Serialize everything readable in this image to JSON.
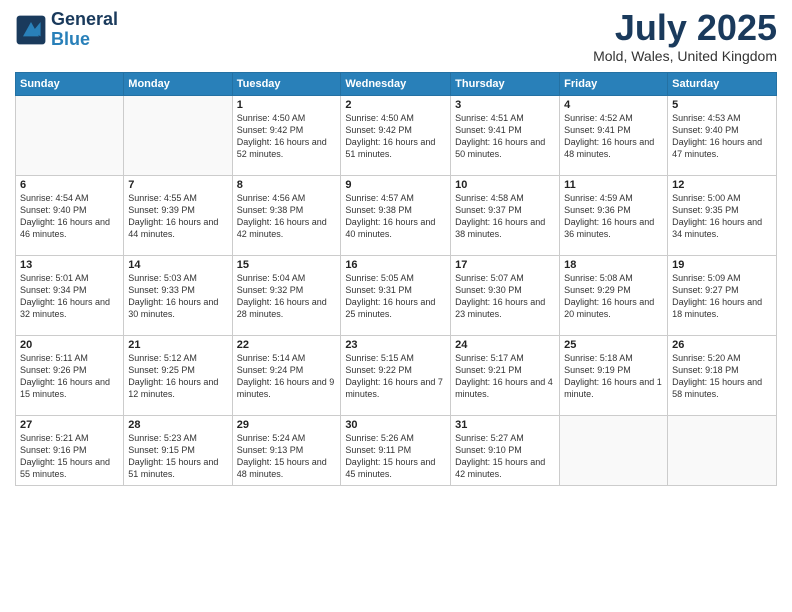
{
  "logo": {
    "line1": "General",
    "line2": "Blue"
  },
  "header": {
    "month": "July 2025",
    "location": "Mold, Wales, United Kingdom"
  },
  "days_of_week": [
    "Sunday",
    "Monday",
    "Tuesday",
    "Wednesday",
    "Thursday",
    "Friday",
    "Saturday"
  ],
  "weeks": [
    [
      {
        "day": "",
        "info": ""
      },
      {
        "day": "",
        "info": ""
      },
      {
        "day": "1",
        "info": "Sunrise: 4:50 AM\nSunset: 9:42 PM\nDaylight: 16 hours and 52 minutes."
      },
      {
        "day": "2",
        "info": "Sunrise: 4:50 AM\nSunset: 9:42 PM\nDaylight: 16 hours and 51 minutes."
      },
      {
        "day": "3",
        "info": "Sunrise: 4:51 AM\nSunset: 9:41 PM\nDaylight: 16 hours and 50 minutes."
      },
      {
        "day": "4",
        "info": "Sunrise: 4:52 AM\nSunset: 9:41 PM\nDaylight: 16 hours and 48 minutes."
      },
      {
        "day": "5",
        "info": "Sunrise: 4:53 AM\nSunset: 9:40 PM\nDaylight: 16 hours and 47 minutes."
      }
    ],
    [
      {
        "day": "6",
        "info": "Sunrise: 4:54 AM\nSunset: 9:40 PM\nDaylight: 16 hours and 46 minutes."
      },
      {
        "day": "7",
        "info": "Sunrise: 4:55 AM\nSunset: 9:39 PM\nDaylight: 16 hours and 44 minutes."
      },
      {
        "day": "8",
        "info": "Sunrise: 4:56 AM\nSunset: 9:38 PM\nDaylight: 16 hours and 42 minutes."
      },
      {
        "day": "9",
        "info": "Sunrise: 4:57 AM\nSunset: 9:38 PM\nDaylight: 16 hours and 40 minutes."
      },
      {
        "day": "10",
        "info": "Sunrise: 4:58 AM\nSunset: 9:37 PM\nDaylight: 16 hours and 38 minutes."
      },
      {
        "day": "11",
        "info": "Sunrise: 4:59 AM\nSunset: 9:36 PM\nDaylight: 16 hours and 36 minutes."
      },
      {
        "day": "12",
        "info": "Sunrise: 5:00 AM\nSunset: 9:35 PM\nDaylight: 16 hours and 34 minutes."
      }
    ],
    [
      {
        "day": "13",
        "info": "Sunrise: 5:01 AM\nSunset: 9:34 PM\nDaylight: 16 hours and 32 minutes."
      },
      {
        "day": "14",
        "info": "Sunrise: 5:03 AM\nSunset: 9:33 PM\nDaylight: 16 hours and 30 minutes."
      },
      {
        "day": "15",
        "info": "Sunrise: 5:04 AM\nSunset: 9:32 PM\nDaylight: 16 hours and 28 minutes."
      },
      {
        "day": "16",
        "info": "Sunrise: 5:05 AM\nSunset: 9:31 PM\nDaylight: 16 hours and 25 minutes."
      },
      {
        "day": "17",
        "info": "Sunrise: 5:07 AM\nSunset: 9:30 PM\nDaylight: 16 hours and 23 minutes."
      },
      {
        "day": "18",
        "info": "Sunrise: 5:08 AM\nSunset: 9:29 PM\nDaylight: 16 hours and 20 minutes."
      },
      {
        "day": "19",
        "info": "Sunrise: 5:09 AM\nSunset: 9:27 PM\nDaylight: 16 hours and 18 minutes."
      }
    ],
    [
      {
        "day": "20",
        "info": "Sunrise: 5:11 AM\nSunset: 9:26 PM\nDaylight: 16 hours and 15 minutes."
      },
      {
        "day": "21",
        "info": "Sunrise: 5:12 AM\nSunset: 9:25 PM\nDaylight: 16 hours and 12 minutes."
      },
      {
        "day": "22",
        "info": "Sunrise: 5:14 AM\nSunset: 9:24 PM\nDaylight: 16 hours and 9 minutes."
      },
      {
        "day": "23",
        "info": "Sunrise: 5:15 AM\nSunset: 9:22 PM\nDaylight: 16 hours and 7 minutes."
      },
      {
        "day": "24",
        "info": "Sunrise: 5:17 AM\nSunset: 9:21 PM\nDaylight: 16 hours and 4 minutes."
      },
      {
        "day": "25",
        "info": "Sunrise: 5:18 AM\nSunset: 9:19 PM\nDaylight: 16 hours and 1 minute."
      },
      {
        "day": "26",
        "info": "Sunrise: 5:20 AM\nSunset: 9:18 PM\nDaylight: 15 hours and 58 minutes."
      }
    ],
    [
      {
        "day": "27",
        "info": "Sunrise: 5:21 AM\nSunset: 9:16 PM\nDaylight: 15 hours and 55 minutes."
      },
      {
        "day": "28",
        "info": "Sunrise: 5:23 AM\nSunset: 9:15 PM\nDaylight: 15 hours and 51 minutes."
      },
      {
        "day": "29",
        "info": "Sunrise: 5:24 AM\nSunset: 9:13 PM\nDaylight: 15 hours and 48 minutes."
      },
      {
        "day": "30",
        "info": "Sunrise: 5:26 AM\nSunset: 9:11 PM\nDaylight: 15 hours and 45 minutes."
      },
      {
        "day": "31",
        "info": "Sunrise: 5:27 AM\nSunset: 9:10 PM\nDaylight: 15 hours and 42 minutes."
      },
      {
        "day": "",
        "info": ""
      },
      {
        "day": "",
        "info": ""
      }
    ]
  ]
}
